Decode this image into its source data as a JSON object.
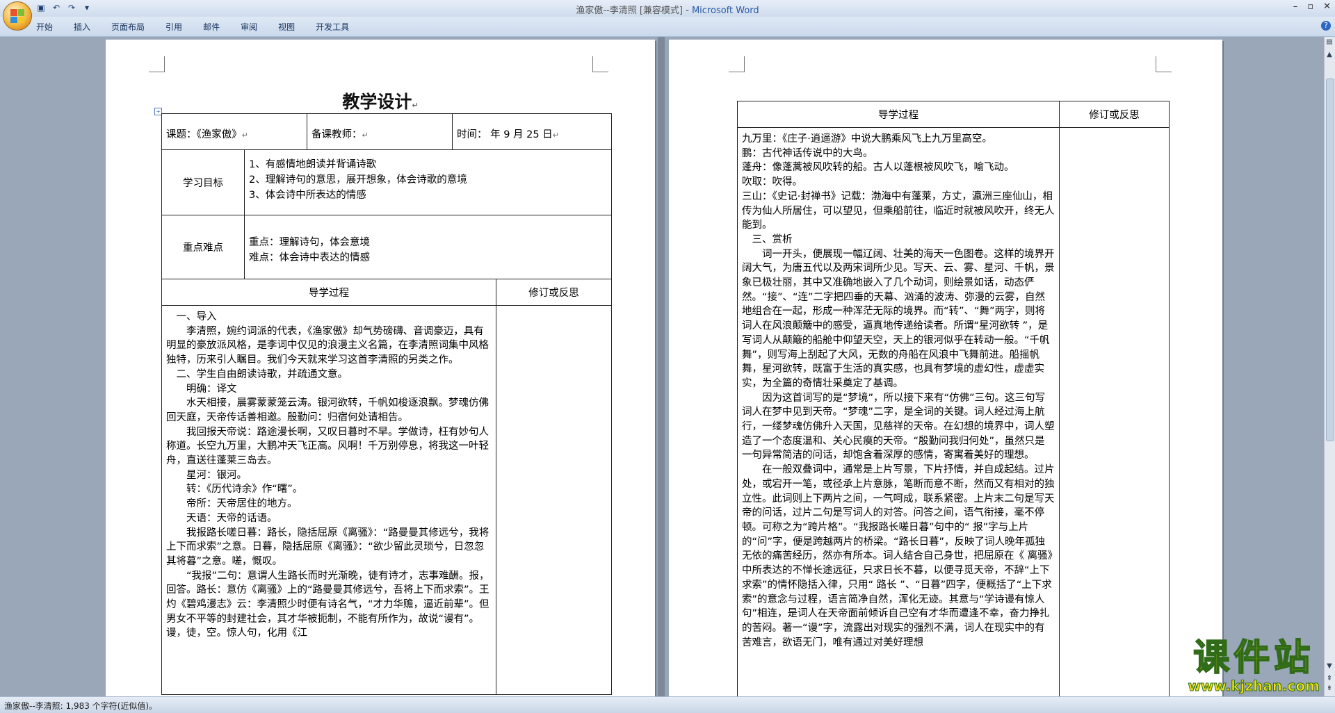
{
  "window": {
    "title": "渔家傲--李清照 [兼容模式] - ",
    "app": "Microsoft Word",
    "controls": [
      "–",
      "▫",
      "✕"
    ]
  },
  "ribbon": {
    "tabs": [
      "开始",
      "插入",
      "页面布局",
      "引用",
      "邮件",
      "审阅",
      "视图",
      "开发工具"
    ]
  },
  "page1": {
    "heading": "教学设计",
    "row1": {
      "course": "课题：《渔家傲》",
      "teacher": "备课教师：",
      "time": "时间：     年 9 月 25 日"
    },
    "goals_label": "学习目标",
    "goals": [
      "1、有感情地朗读并背诵诗歌",
      "2、理解诗句的意思，展开想象，体会诗歌的意境",
      "3、体会诗中所表达的情感"
    ],
    "key_label": "重点难点",
    "key_points": [
      "重点：理解诗句，体会意境",
      "难点：体会诗中表达的情感"
    ],
    "process_header": "导学过程",
    "revise_header": "修订或反思",
    "body": [
      {
        "cls": "sindent",
        "text": "一、导入"
      },
      {
        "cls": "indent",
        "text": "李清照，婉约词派的代表，《渔家傲》却气势磅礴、音调豪迈，具有明显的豪放派风格，是李词中仅见的浪漫主义名篇，在李清照词集中风格独特，历来引人瞩目。我们今天就来学习这首李清照的另类之作。"
      },
      {
        "cls": "sindent",
        "text": "二、学生自由朗读诗歌，并疏通文意。"
      },
      {
        "cls": "indent",
        "text": "明确：译文"
      },
      {
        "cls": "indent",
        "text": "水天相接，晨雾蒙蒙笼云涛。银河欲转，千帆如梭逐浪飘。梦魂仿佛回天庭，天帝传话善相邀。殷勤问：归宿何处请相告。"
      },
      {
        "cls": "indent",
        "text": "我回报天帝说：路途漫长啊，又叹日暮时不早。学做诗，枉有妙句人称道。长空九万里，大鹏冲天飞正高。风啊！千万别停息，将我这一叶轻舟，直送往蓬莱三岛去。"
      },
      {
        "cls": "indent",
        "text": "星河：银河。"
      },
      {
        "cls": "indent",
        "text": "转：《历代诗余》作“曙”。"
      },
      {
        "cls": "indent",
        "text": "帝所：天帝居住的地方。"
      },
      {
        "cls": "indent",
        "text": "天语：天帝的话语。"
      },
      {
        "cls": "indent",
        "text": "我报路长嗟日暮：路长，隐括屈原《离骚》：“路曼曼其修远兮，我将上下而求索”之意。日暮，隐括屈原《离骚》：“欲少留此灵琐兮，日忽忽其将暮”之意。嗟，慨叹。"
      },
      {
        "cls": "indent",
        "text": "“我报”二句：意谓人生路长而时光渐晚，徒有诗才，志事难酬。报，回答。路长：意仿《离骚》上的“路曼曼其修远兮，吾将上下而求索”。王灼《碧鸡漫志》云：李清照少时便有诗名气，“才力华赡，逼近前辈”。但男女不平等的封建社会，其才华被扼制，不能有所作为，故说“谩有”。谩，徒，空。惊人句，化用《江"
      }
    ]
  },
  "page2": {
    "process_header": "导学过程",
    "revise_header": "修订或反思",
    "body": [
      {
        "cls": "",
        "text": "九万里：《庄子·逍遥游》中说大鹏乘风飞上九万里高空。"
      },
      {
        "cls": "",
        "text": "鹏：古代神话传说中的大鸟。"
      },
      {
        "cls": "",
        "text": "蓬舟：像蓬蒿被风吹转的船。古人以蓬根被风吹飞，喻飞动。"
      },
      {
        "cls": "",
        "text": "吹取：吹得。"
      },
      {
        "cls": "",
        "text": "三山：《史记·封禅书》记载：渤海中有蓬莱，方丈，瀛洲三座仙山，相传为仙人所居住，可以望见，但乘船前往，临近时就被风吹开，终无人能到。"
      },
      {
        "cls": "sindent",
        "text": "三、赏析"
      },
      {
        "cls": "indent",
        "text": "词一开头，便展现一幅辽阔、壮美的海天一色图卷。这样的境界开阔大气，为唐五代以及两宋词所少见。写天、云、雾、星河、千帆，景象已极壮丽，其中又准确地嵌入了几个动词，则绘景如话，动态俨然。“接”、“连”二字把四垂的天幕、汹涌的波涛、弥漫的云雾，自然地组合在一起，形成一种浑茫无际的境界。而“转”、“舞”两字，则将词人在风浪颠簸中的感受，逼真地传递给读者。所谓“星河欲转 ”，是写词人从颠簸的船舱中仰望天空，天上的银河似乎在转动一般。“千帆舞”，则写海上刮起了大风，无数的舟船在风浪中飞舞前进。船摇帆舞，星河欲转，既富于生活的真实感，也具有梦境的虚幻性，虚虚实实，为全篇的奇情壮采奠定了基调。"
      },
      {
        "cls": "indent",
        "text": "因为这首词写的是“梦境”，所以接下来有“仿佛”三句。这三句写词人在梦中见到天帝。“梦魂”二字，是全词的关键。词人经过海上航行，一缕梦魂仿佛升入天国，见慈祥的天帝。在幻想的境界中，词人塑造了一个态度温和、关心民瘼的天帝。“殷勤问我归何处”，虽然只是一句异常简洁的问话，却饱含着深厚的感情，寄寓着美好的理想。"
      },
      {
        "cls": "indent",
        "text": "在一般双叠词中，通常是上片写景，下片抒情，并自成起结。过片处，或宕开一笔，或径承上片意脉，笔断而意不断，然而又有相对的独立性。此词则上下两片之间，一气呵成，联系紧密。上片末二句是写天帝的问话，过片二句是写词人的对答。问答之间，语气衔接，毫不停顿。可称之为“跨片格”。“我报路长嗟日暮”句中的“ 报”字与上片的“问”字，便是跨越两片的桥梁。“路长日暮”，反映了词人晚年孤独无依的痛苦经历，然亦有所本。词人结合自己身世，把屈原在《 离骚》中所表达的不惮长途远征，只求日长不暮，以便寻觅天帝，不辞“上下求索”的情怀隐括入律，只用“ 路长 ”、“日暮”四字，便概括了“上下求索”的意念与过程，语言简净自然，浑化无迹。其意与“学诗谩有惊人句”相连，是词人在天帝面前倾诉自己空有才华而遭逢不幸，奋力挣扎的苦闷。著一“谩”字，流露出对现实的强烈不满，词人在现实中的有苦难言，欲语无门，唯有通过对美好理想"
      }
    ]
  },
  "status": {
    "text": "渔家傲--李清照: 1,983 个字符(近似值)。"
  },
  "watermark": {
    "big": "课件站",
    "url": "www.kjzhan.com"
  },
  "paragraph_mark": "↵"
}
